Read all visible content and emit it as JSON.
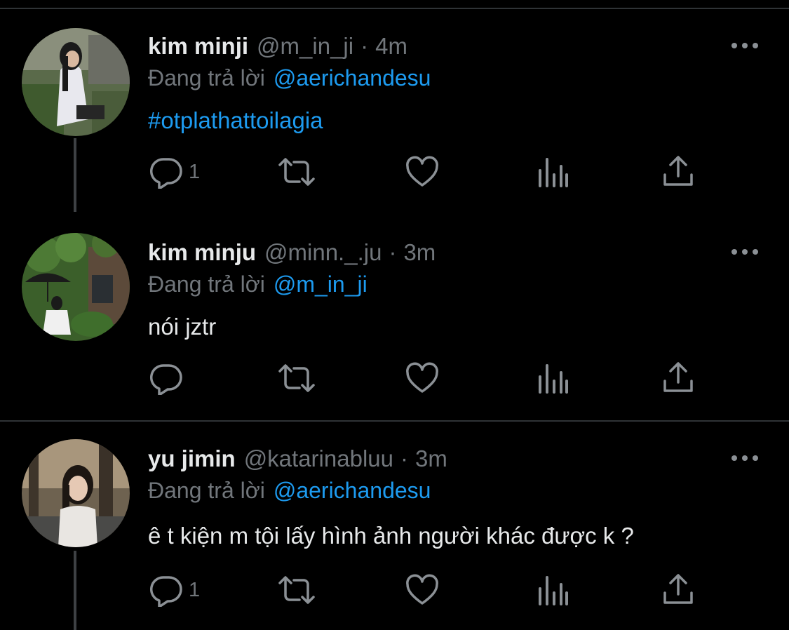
{
  "tweets": [
    {
      "display_name": "kim minji",
      "handle": "@m_in_ji",
      "time": "4m",
      "reply_prefix": "Đang trả lời",
      "reply_to": "@aerichandesu",
      "text": "#otplathattoilagia",
      "reply_count": "1",
      "icons": [
        "comment-icon",
        "retweet-icon",
        "like-icon",
        "analytics-icon",
        "share-icon"
      ]
    },
    {
      "display_name": "kim minju",
      "handle": "@minn._.ju",
      "time": "3m",
      "reply_prefix": "Đang trả lời",
      "reply_to": "@m_in_ji",
      "text": "nói jztr",
      "reply_count": "",
      "icons": [
        "comment-icon",
        "retweet-icon",
        "like-icon",
        "analytics-icon",
        "share-icon"
      ]
    },
    {
      "display_name": "yu jimin",
      "handle": "@katarinabluu",
      "time": "3m",
      "reply_prefix": "Đang trả lời",
      "reply_to": "@aerichandesu",
      "text": "ê t kiện m tội lấy hình ảnh người khác được k ?",
      "reply_count": "1",
      "icons": [
        "comment-icon",
        "retweet-icon",
        "like-icon",
        "analytics-icon",
        "share-icon"
      ]
    }
  ],
  "dot_separator": "·",
  "colors": {
    "background": "#000000",
    "primary_text": "#e7e9ea",
    "secondary_text": "#71767b",
    "link": "#1d9bf0",
    "divider": "#2f3336"
  }
}
